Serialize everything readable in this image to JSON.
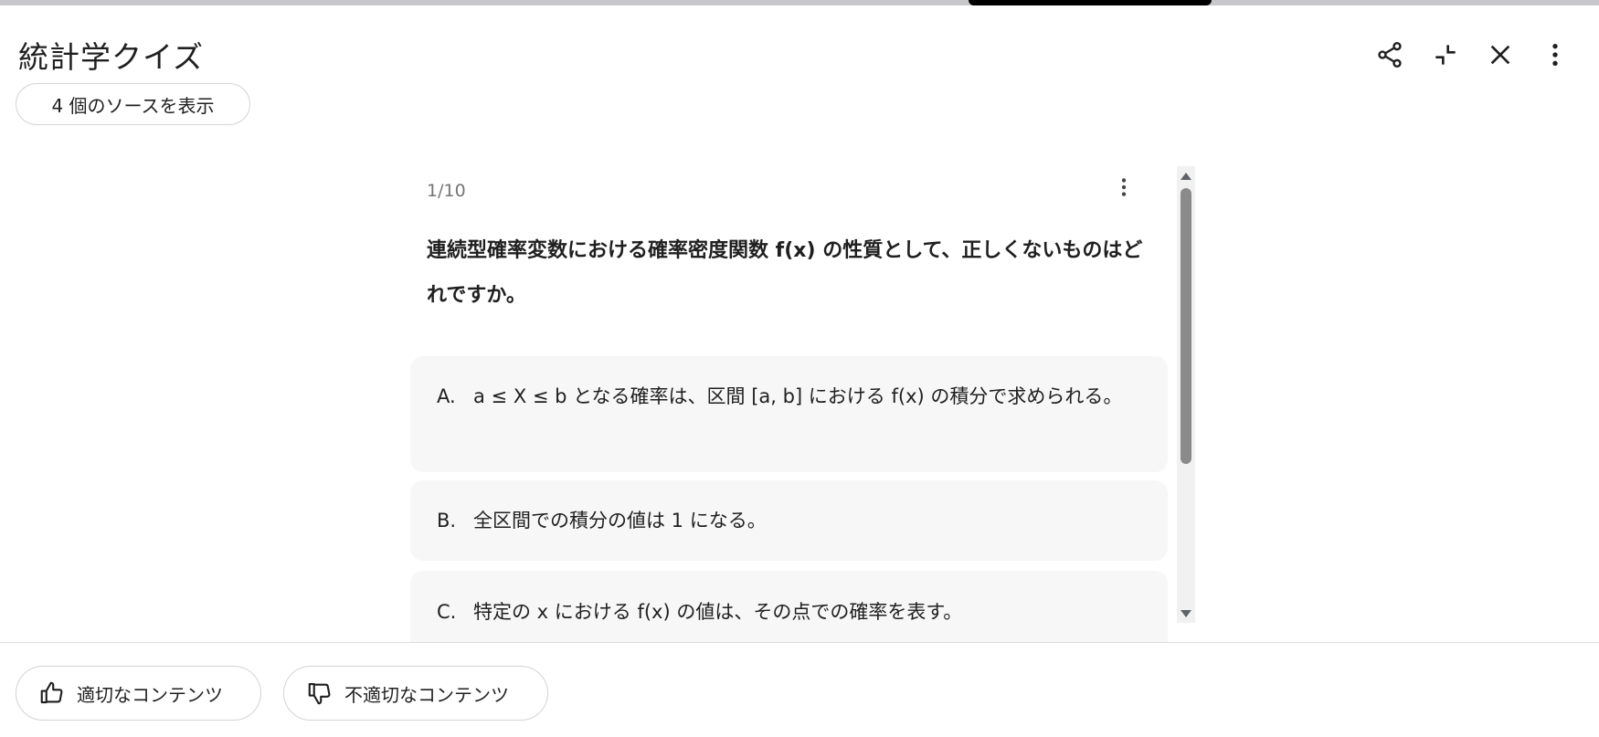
{
  "window": {
    "title": "統計学クイズ",
    "sources_button_label": "4 個のソースを表示"
  },
  "header_icons": [
    "share-icon",
    "collapse-icon",
    "close-icon",
    "more-vert-icon"
  ],
  "quiz": {
    "counter": "1/10",
    "question": "連続型確率変数における確率密度関数 f(x) の性質として、正しくないものはどれですか。",
    "options": [
      {
        "letter": "A.",
        "text": "a ≤ X ≤ b となる確率は、区間 [a, b] における f(x) の積分で求められる。"
      },
      {
        "letter": "B.",
        "text": "全区間での積分の値は 1 になる。"
      },
      {
        "letter": "C.",
        "text": "特定の x における f(x) の値は、その点での確率を表す。"
      }
    ]
  },
  "feedback": {
    "good_label": "適切なコンテンツ",
    "bad_label": "不適切なコンテンツ"
  }
}
